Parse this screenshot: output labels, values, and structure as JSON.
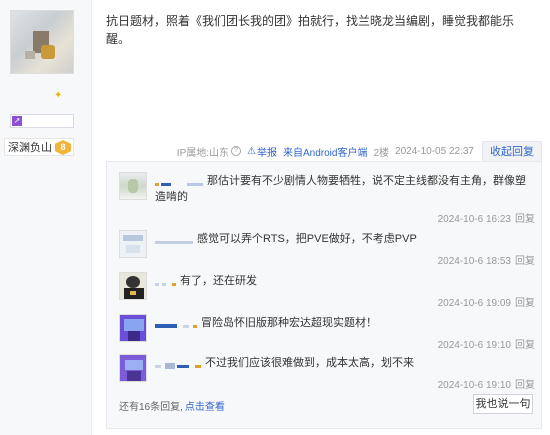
{
  "author": {
    "name": "深渊负山",
    "level": "8"
  },
  "post": {
    "content": "抗日题材，照着《我们团长我的团》拍就行，找兰晓龙当编剧，睡觉我都能乐醒。",
    "ip_location": "IP属地:山东",
    "report_label": "举报",
    "client": "来自Android客户端",
    "floor": "2楼",
    "timestamp": "2024-10-05 22:37",
    "collapse_label": "收起回复"
  },
  "replies": [
    {
      "text": "那估计要有不少剧情人物要牺牲，说不定主线都没有主角，群像塑造啃的",
      "time": "2024-10-6 16:23",
      "reply_label": "回复"
    },
    {
      "text": "感觉可以弄个RTS，把PVE做好，不考虑PVP",
      "time": "2024-10-6 18:53",
      "reply_label": "回复"
    },
    {
      "text": "有了，还在研发",
      "time": "2024-10-6 19:09",
      "reply_label": "回复"
    },
    {
      "text": "冒险岛怀旧版那种宏达超现实题材！",
      "time": "2024-10-6 19:10",
      "reply_label": "回复"
    },
    {
      "text": "不过我们应该很难做到，成本太高，划不来",
      "time": "2024-10-6 19:10",
      "reply_label": "回复"
    }
  ],
  "footer": {
    "more_text": "还有16条回复,",
    "view_label": "点击查看",
    "say_label": "我也说一句"
  }
}
